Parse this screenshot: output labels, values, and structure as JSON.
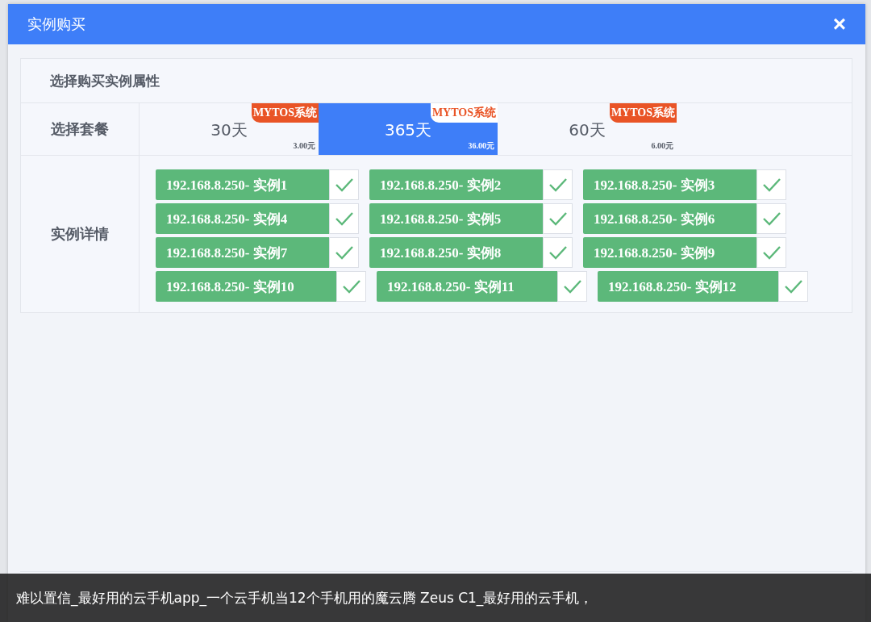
{
  "dialog": {
    "title": "实例购买",
    "close": "×"
  },
  "section_title": "选择购买实例属性",
  "package_row": {
    "label": "选择套餐",
    "packages": [
      {
        "days": "30天",
        "badge": "MYTOS系统",
        "price": "3.00元",
        "selected": false
      },
      {
        "days": "365天",
        "badge": "MYTOS系统",
        "price": "36.00元",
        "selected": true
      },
      {
        "days": "60天",
        "badge": "MYTOS系统",
        "price": "6.00元",
        "selected": false
      }
    ]
  },
  "instance_row": {
    "label": "实例详情",
    "instances": [
      {
        "label": "192.168.8.250- 实例1",
        "checked": true
      },
      {
        "label": "192.168.8.250- 实例2",
        "checked": true
      },
      {
        "label": "192.168.8.250- 实例3",
        "checked": true
      },
      {
        "label": "192.168.8.250- 实例4",
        "checked": true
      },
      {
        "label": "192.168.8.250- 实例5",
        "checked": true
      },
      {
        "label": "192.168.8.250- 实例6",
        "checked": true
      },
      {
        "label": "192.168.8.250- 实例7",
        "checked": true
      },
      {
        "label": "192.168.8.250- 实例8",
        "checked": true
      },
      {
        "label": "192.168.8.250- 实例9",
        "checked": true
      },
      {
        "label": "192.168.8.250- 实例10",
        "checked": true
      },
      {
        "label": "192.168.8.250- 实例11",
        "checked": true
      },
      {
        "label": "192.168.8.250- 实例12",
        "checked": true
      }
    ]
  },
  "caption": "难以置信_最好用的云手机app_一个云手机当12个手机用的魔云腾 Zeus C1_最好用的云手机，"
}
